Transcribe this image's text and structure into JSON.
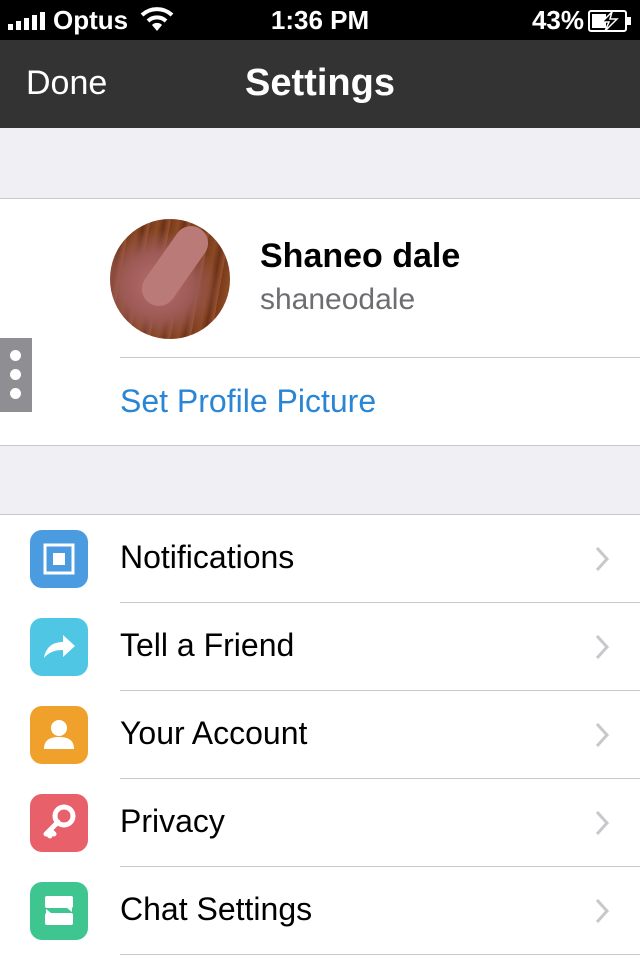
{
  "status_bar": {
    "carrier": "Optus",
    "time": "1:36 PM",
    "battery_percent": "43%"
  },
  "nav": {
    "done_label": "Done",
    "title": "Settings"
  },
  "profile": {
    "name": "Shaneo dale",
    "username": "shaneodale",
    "set_picture_label": "Set Profile Picture"
  },
  "settings": {
    "items": [
      {
        "label": "Notifications",
        "icon": "notifications-icon",
        "color": "#4a9be0"
      },
      {
        "label": "Tell a Friend",
        "icon": "share-arrow-icon",
        "color": "#4fc6e3"
      },
      {
        "label": "Your Account",
        "icon": "person-icon",
        "color": "#f0a12c"
      },
      {
        "label": "Privacy",
        "icon": "key-icon",
        "color": "#e8606a"
      },
      {
        "label": "Chat Settings",
        "icon": "chat-bubbles-icon",
        "color": "#3fc58f"
      }
    ]
  },
  "colors": {
    "nav_background": "#333333",
    "link_blue": "#2a86d4",
    "group_background": "#efeff4"
  }
}
